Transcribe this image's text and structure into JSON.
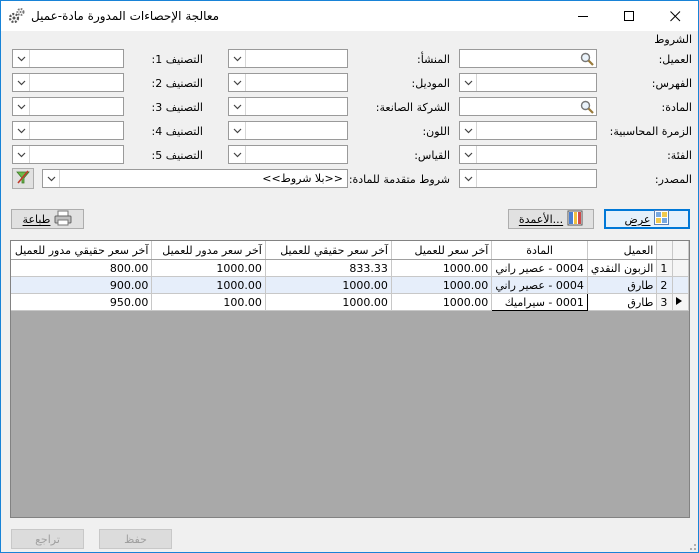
{
  "window": {
    "title": "معالجة الإحصاءات المدورة مادة-عميل"
  },
  "conditions": {
    "group_label": "الشروط",
    "customer_label": "العميل:",
    "index_label": "الفهرس:",
    "material_label": "المادة:",
    "accounting_group_label": "الزمرة المحاسبية:",
    "category_label": "الفئة:",
    "source_label": "المصدر:",
    "origin_label": "المنشأ:",
    "model_label": "الموديل:",
    "manufacturer_label": "الشركة الصانعة:",
    "color_label": "اللون:",
    "size_label": "القياس:",
    "class1_label": "التصنيف 1:",
    "class2_label": "التصنيف 2:",
    "class3_label": "التصنيف 3:",
    "class4_label": "التصنيف 4:",
    "class5_label": "التصنيف 5:",
    "advanced_label": "شروط متقدمة للمادة:",
    "advanced_value": "<<بلا شروط>>"
  },
  "toolbar": {
    "show_label": "عرض",
    "columns_label": "الأعمدة...",
    "print_label": "طباعة"
  },
  "table": {
    "headers": [
      "العميل",
      "المادة",
      "آخر سعر للعميل",
      "آخر سعر حقيقي للعميل",
      "آخر سعر مدور للعميل",
      "آخر سعر حقيقي مدور للعميل"
    ],
    "rows": [
      {
        "num": "1",
        "customer": "الزبون النقدي",
        "material": "0004 - عصير راني",
        "last_price": "1000.00",
        "last_real": "833.33",
        "last_rounded": "1000.00",
        "last_real_rounded": "800.00"
      },
      {
        "num": "2",
        "customer": "طارق",
        "material": "0004 - عصير راني",
        "last_price": "1000.00",
        "last_real": "1000.00",
        "last_rounded": "1000.00",
        "last_real_rounded": "900.00"
      },
      {
        "num": "3",
        "customer": "طارق",
        "material": "0001 - سيراميك",
        "last_price": "1000.00",
        "last_real": "1000.00",
        "last_rounded": "100.00",
        "last_real_rounded": "950.00"
      }
    ]
  },
  "footer": {
    "save_label": "حفظ",
    "undo_label": "تراجع"
  }
}
